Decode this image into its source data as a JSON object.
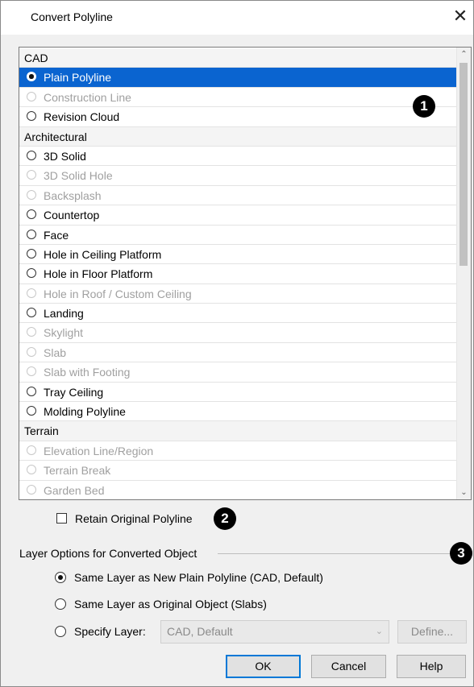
{
  "dialog": {
    "title": "Convert Polyline",
    "close_glyph": "✕"
  },
  "list": {
    "rows": [
      {
        "kind": "header",
        "label": "CAD"
      },
      {
        "kind": "item",
        "label": "Plain Polyline",
        "state": "selected"
      },
      {
        "kind": "item",
        "label": "Construction Line",
        "state": "disabled"
      },
      {
        "kind": "item",
        "label": "Revision Cloud",
        "state": "enabled"
      },
      {
        "kind": "header",
        "label": "Architectural"
      },
      {
        "kind": "item",
        "label": "3D Solid",
        "state": "enabled"
      },
      {
        "kind": "item",
        "label": "3D Solid Hole",
        "state": "disabled"
      },
      {
        "kind": "item",
        "label": "Backsplash",
        "state": "disabled"
      },
      {
        "kind": "item",
        "label": "Countertop",
        "state": "enabled"
      },
      {
        "kind": "item",
        "label": "Face",
        "state": "enabled"
      },
      {
        "kind": "item",
        "label": "Hole in Ceiling Platform",
        "state": "enabled"
      },
      {
        "kind": "item",
        "label": "Hole in Floor Platform",
        "state": "enabled"
      },
      {
        "kind": "item",
        "label": "Hole in Roof / Custom Ceiling",
        "state": "disabled"
      },
      {
        "kind": "item",
        "label": "Landing",
        "state": "enabled"
      },
      {
        "kind": "item",
        "label": "Skylight",
        "state": "disabled"
      },
      {
        "kind": "item",
        "label": "Slab",
        "state": "disabled"
      },
      {
        "kind": "item",
        "label": "Slab with Footing",
        "state": "disabled"
      },
      {
        "kind": "item",
        "label": "Tray Ceiling",
        "state": "enabled"
      },
      {
        "kind": "item",
        "label": "Molding Polyline",
        "state": "enabled"
      },
      {
        "kind": "header",
        "label": "Terrain"
      },
      {
        "kind": "item",
        "label": "Elevation Line/Region",
        "state": "disabled"
      },
      {
        "kind": "item",
        "label": "Terrain Break",
        "state": "disabled"
      },
      {
        "kind": "item",
        "label": "Garden Bed",
        "state": "disabled"
      }
    ],
    "scroll_up_glyph": "⌃",
    "scroll_down_glyph": "⌄"
  },
  "callouts": {
    "one": "1",
    "two": "2",
    "three": "3"
  },
  "retain": {
    "label": "Retain Original Polyline",
    "checked": false
  },
  "layer_options": {
    "group_label": "Layer Options for Converted Object",
    "options": [
      {
        "label": "Same Layer as New Plain Polyline (CAD,  Default)",
        "checked": true
      },
      {
        "label": "Same Layer as Original Object (Slabs)",
        "checked": false
      },
      {
        "label": "Specify Layer:",
        "checked": false
      }
    ],
    "layer_combo_value": "CAD,  Default",
    "combo_arrow_glyph": "⌄",
    "define_label": "Define..."
  },
  "buttons": {
    "ok": "OK",
    "cancel": "Cancel",
    "help": "Help"
  }
}
